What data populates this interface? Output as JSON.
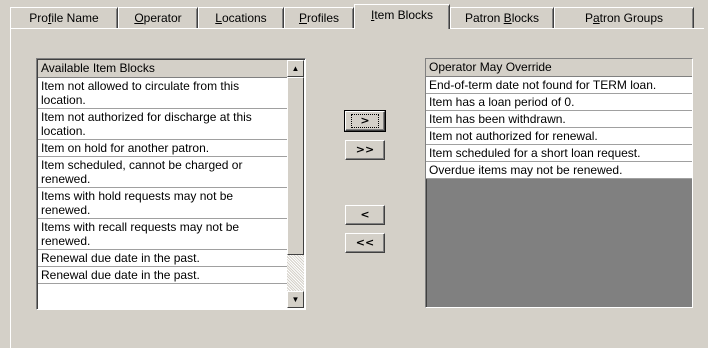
{
  "tabs": [
    {
      "pre": "Pro",
      "key": "f",
      "post": "ile Name",
      "active": false
    },
    {
      "pre": "",
      "key": "O",
      "post": "perator",
      "active": false
    },
    {
      "pre": "",
      "key": "L",
      "post": "ocations",
      "active": false
    },
    {
      "pre": "",
      "key": "P",
      "post": "rofiles",
      "active": false
    },
    {
      "pre": "",
      "key": "I",
      "post": "tem Blocks",
      "active": true
    },
    {
      "pre": "Patron ",
      "key": "B",
      "post": "locks",
      "active": false
    },
    {
      "pre": "P",
      "key": "a",
      "post": "tron Groups",
      "active": false
    }
  ],
  "available": {
    "header": "Available Item Blocks",
    "items": [
      "Item not allowed to circulate from this location.",
      "Item not authorized for discharge at this location.",
      "Item on hold for another patron.",
      "Item scheduled, cannot be charged or renewed.",
      "Items with hold requests may not be renewed.",
      "Items with recall requests may not be renewed.",
      "Renewal due date in the past.",
      "Renewal due date in the past."
    ]
  },
  "override": {
    "header": "Operator May Override",
    "items": [
      "End-of-term date not found for TERM loan.",
      "Item has a loan period of 0.",
      "Item has been withdrawn.",
      "Item not authorized for renewal.",
      "Item scheduled for a short loan request.",
      "Overdue items may not be renewed."
    ]
  },
  "buttons": {
    "add": ">",
    "add_all": ">>",
    "remove": "<",
    "remove_all": "<<"
  },
  "scroll": {
    "up": "▲",
    "down": "▼"
  }
}
